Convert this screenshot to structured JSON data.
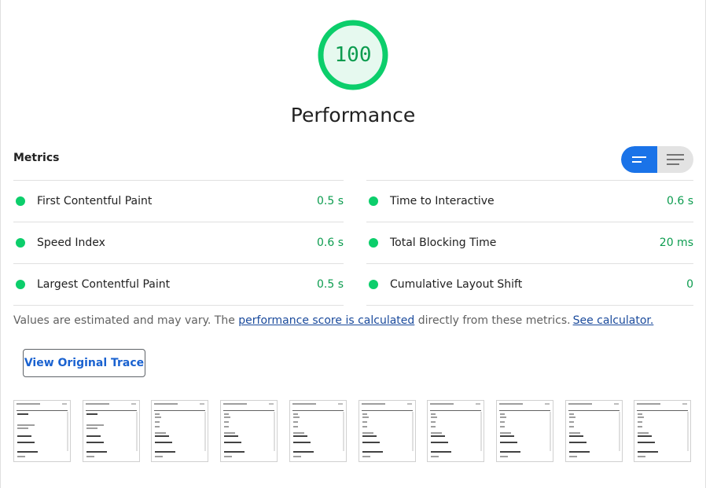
{
  "gauge": {
    "score": "100",
    "title": "Performance",
    "fraction": 1.0,
    "color": "#0cce6b"
  },
  "metrics": {
    "header": "Metrics",
    "toggle": {
      "selected": "list-view",
      "options": [
        "bars-icon",
        "lines-icon"
      ]
    },
    "left": [
      {
        "label": "First Contentful Paint",
        "value": "0.5 s"
      },
      {
        "label": "Speed Index",
        "value": "0.6 s"
      },
      {
        "label": "Largest Contentful Paint",
        "value": "0.5 s"
      }
    ],
    "right": [
      {
        "label": "Time to Interactive",
        "value": "0.6 s"
      },
      {
        "label": "Total Blocking Time",
        "value": "20 ms"
      },
      {
        "label": "Cumulative Layout Shift",
        "value": "0"
      }
    ],
    "pass_color": "#0cce6b"
  },
  "note": {
    "prefix": "Values are estimated and may vary. The ",
    "link1": "performance score is calculated",
    "middle": " directly from these metrics.",
    "link2": "See calculator."
  },
  "trace_button": "View Original Trace",
  "filmstrip": {
    "frame_count": 10
  }
}
